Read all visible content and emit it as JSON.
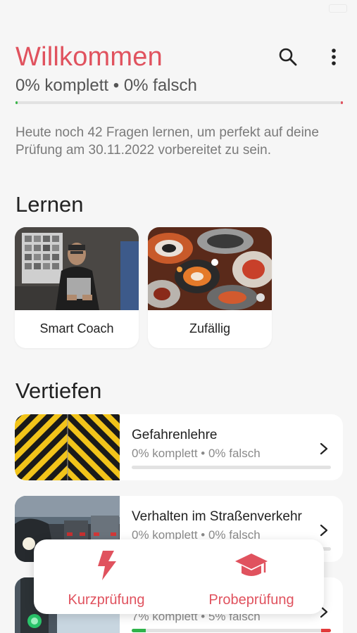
{
  "header": {
    "title": "Willkommen",
    "progress_complete": "0% komplett",
    "separator": "•",
    "progress_wrong": "0% falsch"
  },
  "intro_text": "Heute noch 42 Fragen lernen, um perfekt auf deine Prüfung am 30.11.2022 vorbereitet zu sein.",
  "learn": {
    "title": "Lernen",
    "cards": [
      {
        "label": "Smart Coach"
      },
      {
        "label": "Zufällig"
      }
    ]
  },
  "deepen": {
    "title": "Vertiefen",
    "topics": [
      {
        "name": "Gefahrenlehre",
        "stats": "0% komplett • 0% falsch",
        "complete": 0,
        "wrong": 0
      },
      {
        "name": "Verhalten im Straßenverkehr",
        "stats": "0% komplett • 0% falsch",
        "complete": 0,
        "wrong": 0
      },
      {
        "name": "",
        "stats": "7% komplett • 5% falsch",
        "complete": 7,
        "wrong": 5
      }
    ]
  },
  "bottom_tabs": [
    {
      "label": "Kurzprüfung",
      "icon": "lightning-icon"
    },
    {
      "label": "Probeprüfung",
      "icon": "graduation-cap-icon"
    }
  ],
  "colors": {
    "accent": "#e0525e",
    "progress_green": "#2fb34a",
    "progress_red": "#e23b3b"
  }
}
